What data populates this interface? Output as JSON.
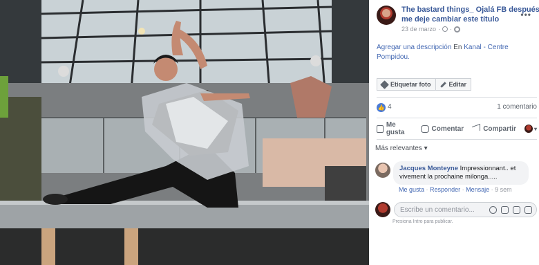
{
  "post": {
    "author": "The bastard things_ Ojalá FB después me deje cambiar este título",
    "date": "23 de marzo",
    "more": "•••",
    "description_prefix": "Agregar una descripción",
    "description_in": " En ",
    "location": "Kanal - Centre Pompidou.",
    "tag_button": "Etiquetar foto",
    "edit_button": "Editar"
  },
  "stats": {
    "likes": "4",
    "comments": "1 comentario"
  },
  "actions": {
    "like": "Me gusta",
    "comment": "Comentar",
    "share": "Compartir",
    "caret": "▾"
  },
  "comments": {
    "relevance_label": "Más relevantes",
    "relevance_caret": "▾",
    "items": [
      {
        "name": "Jacques Monteyne",
        "text": " Impressionnant.. et vivement la prochaine milonga.....",
        "like": "Me gusta",
        "reply": "Responder",
        "message": "Mensaje",
        "time": "9 sem"
      }
    ],
    "composer_placeholder": "Escribe un comentario...",
    "composer_hint": "Presiona Intro para publicar."
  },
  "colors": {
    "link": "#385898",
    "muted": "#90949c",
    "accent": "#4267b2"
  },
  "icons": [
    "tag-icon",
    "pencil-icon",
    "like-badge-icon",
    "thumb-icon",
    "comment-icon",
    "share-icon",
    "emoji-icon",
    "camera-icon",
    "gif-icon",
    "sticker-icon"
  ]
}
